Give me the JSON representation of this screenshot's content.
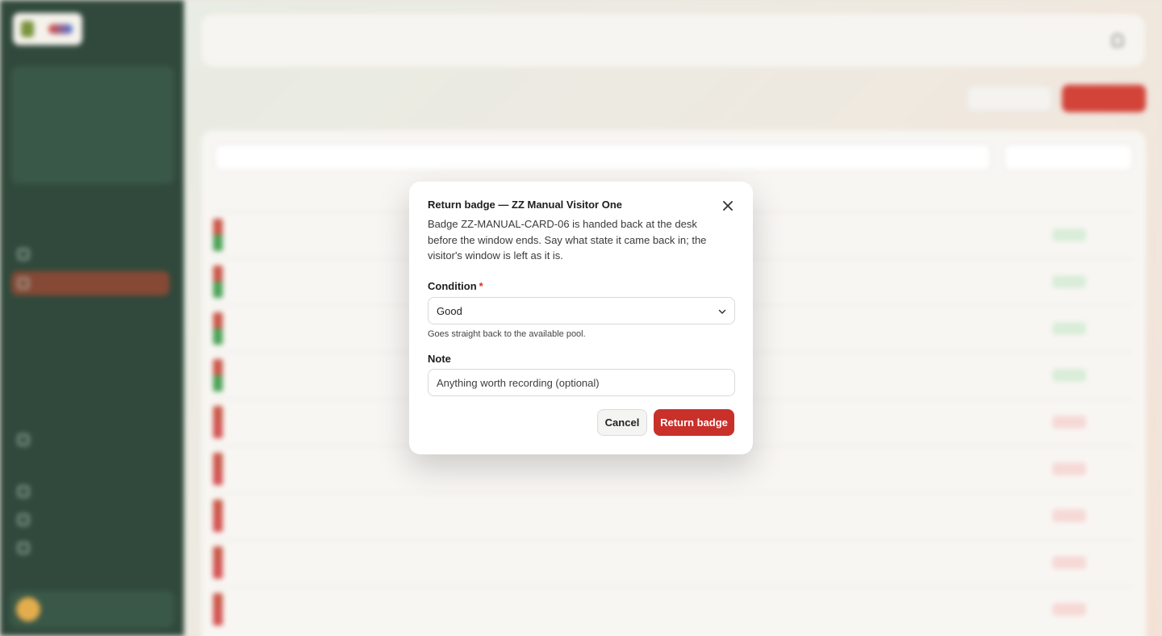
{
  "dialog": {
    "title": "Return badge — ZZ Manual Visitor One",
    "description": "Badge ZZ-MANUAL-CARD-06 is handed back at the desk before the window ends. Say what state it came back in; the visitor's window is left as it is.",
    "condition_label": "Condition",
    "required_mark": "*",
    "condition_value": "Good",
    "condition_hint": "Goes straight back to the available pool.",
    "note_label": "Note",
    "note_placeholder": "Anything worth recording (optional)",
    "cancel_label": "Cancel",
    "submit_label": "Return badge",
    "close_icon": "close-icon",
    "chevron_icon": "chevron-down-icon"
  },
  "colors": {
    "primary": "#c9302a",
    "sidebar": "#1f3a2c"
  }
}
